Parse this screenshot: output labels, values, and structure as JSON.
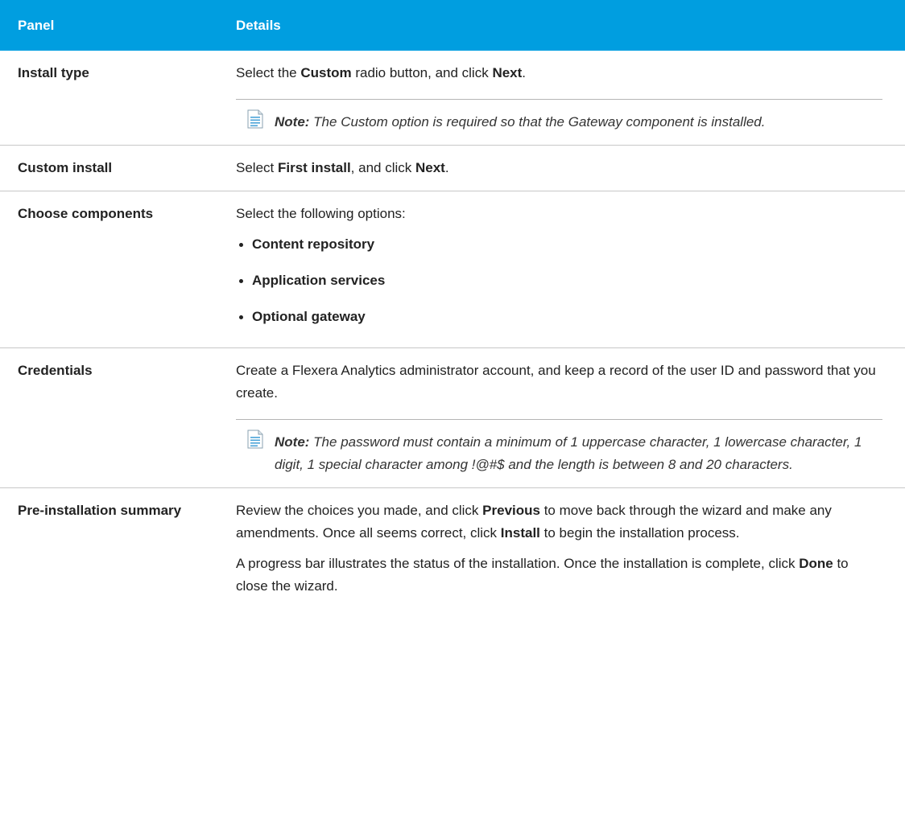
{
  "table": {
    "header": {
      "panel": "Panel",
      "details": "Details"
    },
    "rows": [
      {
        "panel": "Install type",
        "p1": [
          "Select the ",
          "Custom",
          " radio button, and click ",
          "Next",
          "."
        ],
        "note": {
          "label": "Note:",
          "text": " The Custom option is required so that the Gateway component is installed."
        }
      },
      {
        "panel": "Custom install",
        "p1": [
          "Select ",
          "First install",
          ", and click ",
          "Next",
          "."
        ]
      },
      {
        "panel": "Choose components",
        "intro": "Select the following options:",
        "options": [
          "Content repository",
          "Application services",
          "Optional gateway"
        ]
      },
      {
        "panel": "Credentials",
        "p1": "Create a Flexera Analytics administrator account, and keep a record of the user ID and password that you create.",
        "note": {
          "label": "Note:",
          "text": " The password must contain a minimum of 1 uppercase character, 1 lowercase character, 1 digit, 1 special character among !@#$ and the length is between 8 and 20 characters."
        }
      },
      {
        "panel": "Pre-installation summary",
        "p1": [
          "Review the choices you made, and click ",
          "Previous",
          " to move back through the wizard and make any amendments. Once all seems correct, click ",
          "Install",
          " to begin the installation process."
        ],
        "p2": [
          "A progress bar illustrates the status of the installation. Once the installation is complete, click ",
          "Done",
          " to close the wizard."
        ]
      }
    ]
  },
  "icons": {
    "note": "note-document-icon"
  },
  "colors": {
    "header_bg": "#009ee0",
    "header_text": "#ffffff",
    "divider": "#c8c8c8"
  }
}
